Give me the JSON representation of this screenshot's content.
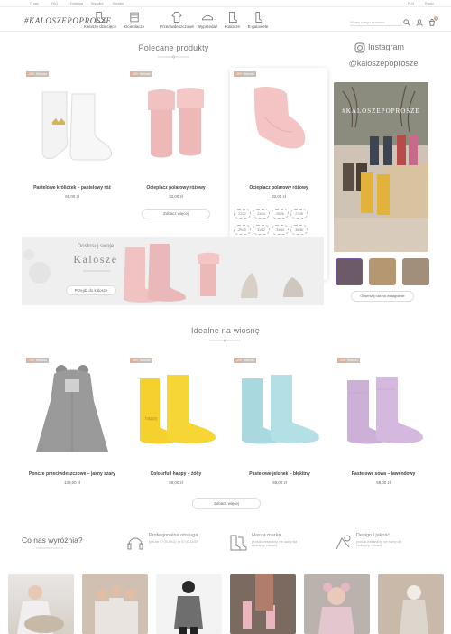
{
  "topbar": {
    "left_links": [
      "O nas",
      "FAQ",
      "Dostawa",
      "Wysyłka",
      "Kontakt"
    ],
    "language": "PLN",
    "account": "Polski"
  },
  "header": {
    "logo": "#KALOSZEPOPROSZE",
    "nav": [
      {
        "label": "Kalosze dziecięce",
        "icon": "boot-icon"
      },
      {
        "label": "Ocieplacze",
        "icon": "warmer-icon"
      },
      {
        "label": "Przeciwdeszczowe",
        "icon": "raincoat-icon"
      },
      {
        "label": "Wyprzedaż",
        "icon": "sale-shoe-icon"
      },
      {
        "label": "Kalosze",
        "icon": "wellington-icon"
      },
      {
        "label": "E-gutowele",
        "icon": "gift-boot-icon"
      }
    ],
    "search_placeholder": "Wpisz czego szukasz...",
    "cart_count": "0"
  },
  "recommended": {
    "title": "Polecane produkty",
    "products": [
      {
        "name": "Pastelowe króliczek – pastelowy róż",
        "price": "69,00 zł",
        "badges": [
          "-10%",
          "Nowość"
        ],
        "color": "#f2f2f2"
      },
      {
        "name": "Ocieplacz polarowy różowy",
        "price": "32,00 zł",
        "badges": [
          "-10%",
          "Nowość"
        ],
        "color": "#eeb8b8"
      },
      {
        "name": "Ocieplacz polarowy różowy",
        "price": "32,00 zł",
        "badges": [
          "-10%",
          "Nowość"
        ],
        "color": "#f4c4c4"
      }
    ],
    "more_button": "Zobacz więcej",
    "add_to_cart": "Dodaj do koszyka",
    "sizes": [
      "21/22",
      "23/24",
      "25/26",
      "27/28",
      "29/30",
      "31/32",
      "33/34",
      "35/36",
      "37/38",
      "39/40",
      "41/42",
      "43/44"
    ]
  },
  "banner": {
    "line1": "Dostosuj swoje",
    "line2": "Kalosze",
    "button": "Przejdź do kalosze"
  },
  "instagram": {
    "title": "Instagram",
    "handle": "@kaloszepoprosze",
    "photo_label": "#KALOSZEPOPROSZE",
    "follow_button": "Obserwuj nas na instagramie"
  },
  "spring": {
    "title": "Idealne na wiosnę",
    "products": [
      {
        "name": "Poncze przeciwdeszczowe – jasny szary",
        "price": "139,00 zł",
        "badges": [
          "-10%",
          "Nowość"
        ],
        "color": "#9a9a9a"
      },
      {
        "name": "Colourfull happy – żółty",
        "price": "69,00 zł",
        "badges": [
          "-10%",
          "Nowość"
        ],
        "color": "#f4d12c"
      },
      {
        "name": "Pastelowe jelonek – błękitny",
        "price": "69,00 zł",
        "badges": [
          "-10%",
          "Nowość"
        ],
        "color": "#a9d9de"
      },
      {
        "name": "Pastelowe sowa – lawendowy",
        "price": "69,00 zł",
        "badges": [
          "-10%",
          "Nowość"
        ],
        "color": "#cdb0d8"
      }
    ],
    "more_button": "Zobacz więcej"
  },
  "features": {
    "title": "Co nas wyróżnia?",
    "items": [
      {
        "title": "Profesjonalna obsługa",
        "desc": "pon-nie 07:00-15:00, pt 07:00-14:00",
        "icon": "headset-icon"
      },
      {
        "title": "Nasza marka",
        "desc": "produkt niebanalny, nie tuziny dla zadbajmy, ciekawy",
        "icon": "boots-icon"
      },
      {
        "title": "Design i jakość",
        "desc": "produkt niebanalny, nie tuziny dla zadbajmy, ciekawy",
        "icon": "design-icon"
      }
    ]
  },
  "colors": {
    "accent": "#c9a88e",
    "text": "#555555",
    "border": "#dddddd"
  }
}
